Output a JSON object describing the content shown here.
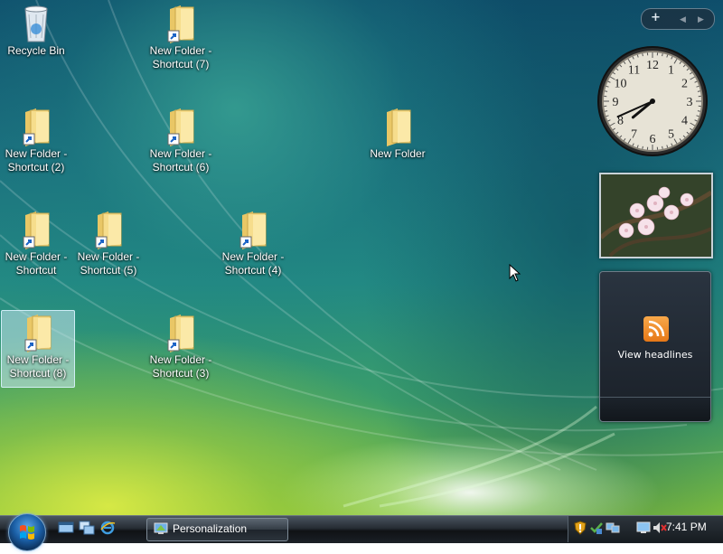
{
  "desktop": {
    "icons": [
      {
        "label": "Recycle Bin",
        "type": "recycle-bin"
      },
      {
        "label": "New Folder - Shortcut (7)",
        "type": "folder-shortcut"
      },
      {
        "label": "New Folder - Shortcut (2)",
        "type": "folder-shortcut"
      },
      {
        "label": "New Folder - Shortcut (6)",
        "type": "folder-shortcut"
      },
      {
        "label": "New Folder",
        "type": "folder"
      },
      {
        "label": "New Folder - Shortcut",
        "type": "folder-shortcut"
      },
      {
        "label": "New Folder - Shortcut (5)",
        "type": "folder-shortcut"
      },
      {
        "label": "New Folder - Shortcut (4)",
        "type": "folder-shortcut"
      },
      {
        "label": "New Folder - Shortcut (8)",
        "type": "folder-shortcut",
        "selected": true
      },
      {
        "label": "New Folder - Shortcut (3)",
        "type": "folder-shortcut"
      }
    ]
  },
  "sidebar": {
    "controls": {
      "add": "+",
      "prev": "◀",
      "next": "▶"
    },
    "clock": {
      "hours": 7,
      "minutes": 41,
      "numerals": [
        "12",
        "1",
        "2",
        "3",
        "4",
        "5",
        "6",
        "7",
        "8",
        "9",
        "10",
        "11"
      ]
    },
    "feeds": {
      "caption": "View headlines"
    }
  },
  "taskbar": {
    "start": "start-orb",
    "quick_launch": [
      "show-desktop-icon",
      "switch-windows-icon",
      "internet-explorer-icon"
    ],
    "task_button": {
      "label": "Personalization"
    },
    "tray_icons": [
      "security-shield-icon",
      "windows-defender-icon",
      "network-icon",
      "display-icon",
      "volume-muted-icon"
    ],
    "clock": "7:41 PM"
  },
  "colors": {
    "taskbar": "#1b2026",
    "feed_orange": "#e67817",
    "desktop_teal": "#238a83",
    "desktop_yellow": "#e6f046"
  }
}
